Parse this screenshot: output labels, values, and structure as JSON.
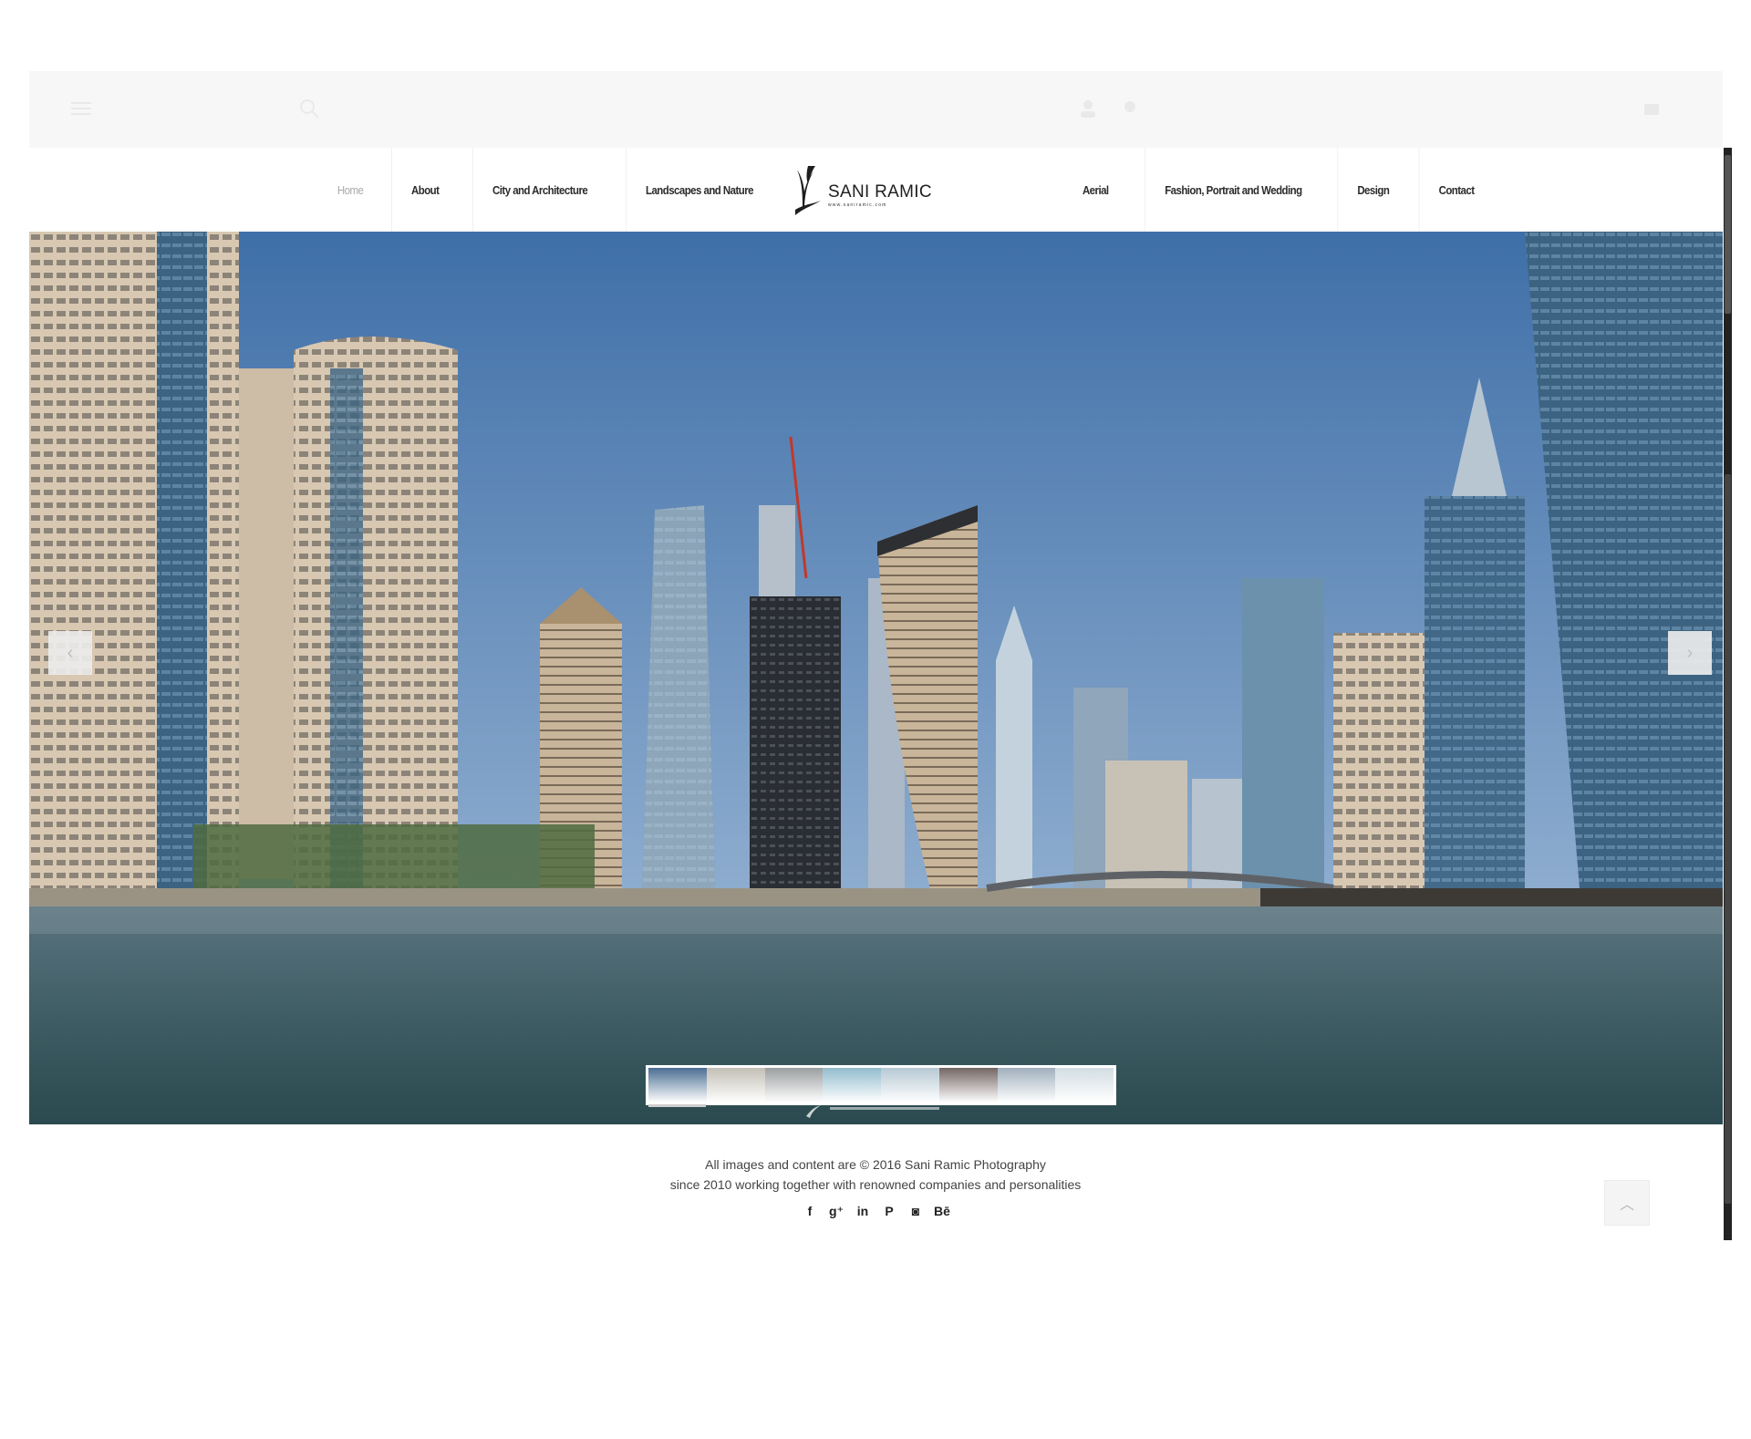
{
  "nav": {
    "left_items": [
      {
        "label": "Home",
        "active": true
      },
      {
        "label": "About"
      },
      {
        "label": "City and Architecture"
      },
      {
        "label": "Landscapes and Nature"
      }
    ],
    "right_items": [
      {
        "label": "Aerial"
      },
      {
        "label": "Fashion, Portrait and Wedding"
      },
      {
        "label": "Design"
      },
      {
        "label": "Contact"
      }
    ]
  },
  "logo": {
    "name": "SANI RAMIC",
    "url": "www.saniramic.com"
  },
  "slider": {
    "prev_icon": "chevron-left-icon",
    "next_icon": "chevron-right-icon",
    "thumbnail_count": 8,
    "active_thumbnail": 1,
    "thumbnail_colors": [
      "#4a6e93",
      "#b8b4a8",
      "#8a8e8f",
      "#7fb0c4",
      "#a9bfcc",
      "#5a4a46",
      "#8fa1b1",
      "#cbd7dc"
    ]
  },
  "footer": {
    "copyright": "All images and content are © 2016 Sani Ramic Photography",
    "tagline": "since 2010 working together with renowned companies and personalities",
    "social": [
      {
        "name": "facebook-icon",
        "glyph": "f"
      },
      {
        "name": "google-plus-icon",
        "glyph": "g⁺"
      },
      {
        "name": "linkedin-icon",
        "glyph": "in"
      },
      {
        "name": "pinterest-icon",
        "glyph": "P"
      },
      {
        "name": "instagram-icon",
        "glyph": "◙"
      },
      {
        "name": "behance-icon",
        "glyph": "Bē"
      }
    ]
  },
  "back_to_top_icon": "chevron-up-icon",
  "colors": {
    "sky_top": "#3f6fa8",
    "sky_bottom": "#a9c2dc",
    "water_top": "#5a7480",
    "water_bottom": "#2a4a4f",
    "nav_text": "#2c2c2c",
    "nav_active": "#a9a9a9"
  }
}
